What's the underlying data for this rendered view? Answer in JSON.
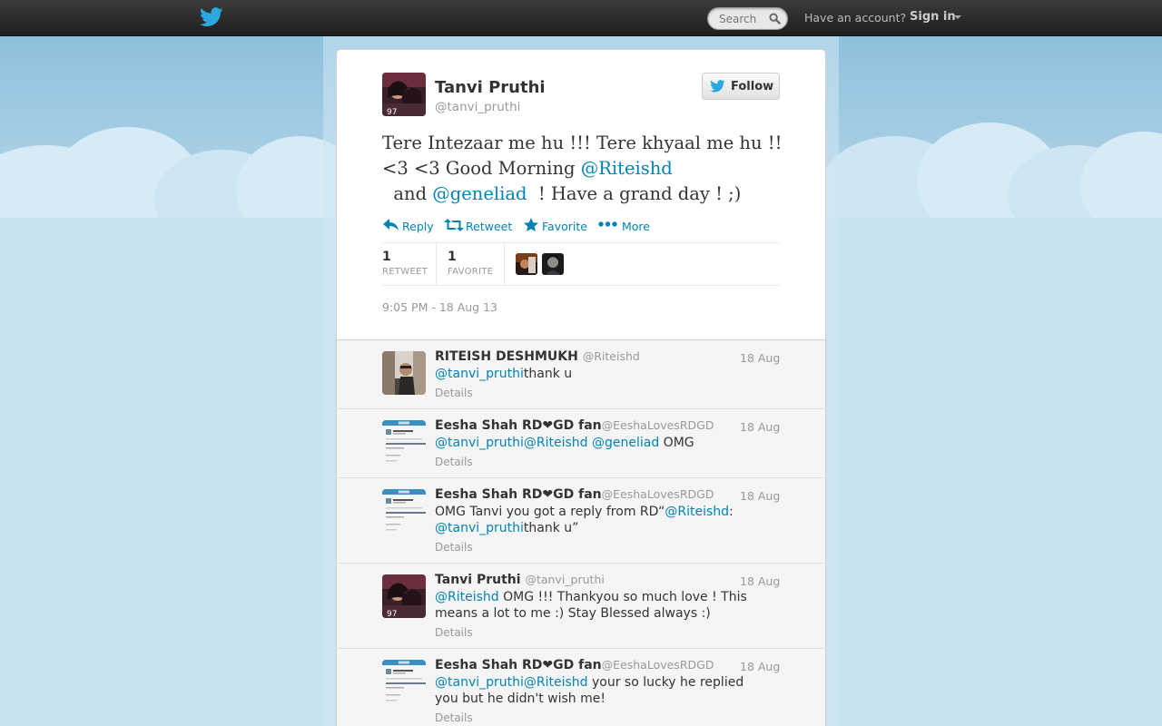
{
  "topbar": {
    "search_placeholder": "Search",
    "have_account": "Have an account?",
    "sign_in": "Sign in"
  },
  "tweet": {
    "author_name": "Tanvi Pruthi",
    "author_handle": "@tanvi_pruthi",
    "follow_label": "Follow",
    "text_parts": {
      "p1": "Tere Intezaar me hu !!! Tere khyaal me hu !! <3 <3 Good Morning ",
      "m1": "@Riteishd",
      "p2": "  and ",
      "m2": "@geneliad",
      "p3": "  ! Have a grand day ! ;)"
    },
    "actions": {
      "reply": "Reply",
      "retweet": "Retweet",
      "favorite": "Favorite",
      "more": "More"
    },
    "stats": {
      "retweets_count": "1",
      "retweets_label": "RETWEET",
      "favorites_count": "1",
      "favorites_label": "FAVORITE"
    },
    "timestamp": "9:05 PM - 18 Aug 13"
  },
  "replies": [
    {
      "name": "RITEISH DESHMUKH",
      "handle": "@Riteishd",
      "date": "18 Aug",
      "mentions": "@tanvi_pruthi",
      "text": "thank u",
      "details": "Details"
    },
    {
      "name": "Eesha Shah RD❤GD fan",
      "handle": "@EeshaLovesRDGD",
      "date": "18 Aug",
      "mentions": "@tanvi_pruthi@Riteishd @geneliad",
      "text": " OMG",
      "details": "Details"
    },
    {
      "name": "Eesha Shah RD❤GD fan",
      "handle": "@EeshaLovesRDGD",
      "date": "18 Aug",
      "text_before": "OMG Tanvi you got a reply from RD“",
      "mention1": "@Riteishd",
      "text_mid": ": ",
      "mention2": "@tanvi_pruthi",
      "text_after": "thank u”",
      "details": "Details"
    },
    {
      "name": "Tanvi Pruthi",
      "handle": "@tanvi_pruthi",
      "date": "18 Aug",
      "mentions": "@Riteishd",
      "text": " OMG !!! Thankyou so much love ! This means a lot to me :) Stay Blessed always :)",
      "details": "Details"
    },
    {
      "name": "Eesha Shah RD❤GD fan",
      "handle": "@EeshaLovesRDGD",
      "date": "18 Aug",
      "mentions": "@tanvi_pruthi@Riteishd",
      "text": " your so lucky he replied you but he didn't wish me!",
      "details": "Details"
    }
  ],
  "colors": {
    "link": "#0084b4",
    "topbar": "#2b2b2b",
    "sky": "#c0deed",
    "twitter_blue": "#2aa9e0"
  },
  "icons": {
    "logo": "twitter-bird-icon",
    "search": "magnifier-icon",
    "reply": "reply-arrow-icon",
    "retweet": "retweet-icon",
    "favorite": "star-icon",
    "more": "ellipsis-icon"
  }
}
